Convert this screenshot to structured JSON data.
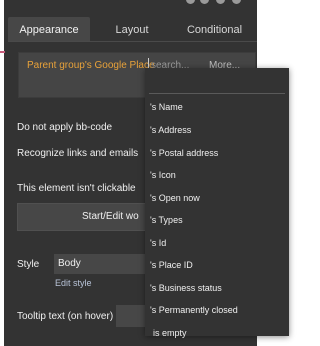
{
  "tabs": [
    {
      "label": "Appearance",
      "active": true
    },
    {
      "label": "Layout",
      "active": false
    },
    {
      "label": "Conditional",
      "active": false
    }
  ],
  "expression": {
    "chip": "Parent group's Google Place",
    "search_placeholder": "search...",
    "more_label": "More..."
  },
  "options": {
    "bbcode": "Do not apply bb-code",
    "links": "Recognize links and emails",
    "clickable": "This element isn't clickable"
  },
  "workflow_button": "Start/Edit wo",
  "style": {
    "label": "Style",
    "value": "Body",
    "edit_link": "Edit style"
  },
  "tooltip": {
    "label": "Tooltip text (on hover)"
  },
  "dropdown_items": [
    "'s Name",
    "'s Address",
    "'s Postal address",
    "'s Icon",
    "'s Open now",
    "'s Types",
    "'s Id",
    "'s Place ID",
    "'s Business status",
    "'s Permanently closed",
    "is empty"
  ],
  "colors": {
    "panel": "#333333",
    "accent_orange": "#e8a23a",
    "link": "#b9c4d8"
  }
}
